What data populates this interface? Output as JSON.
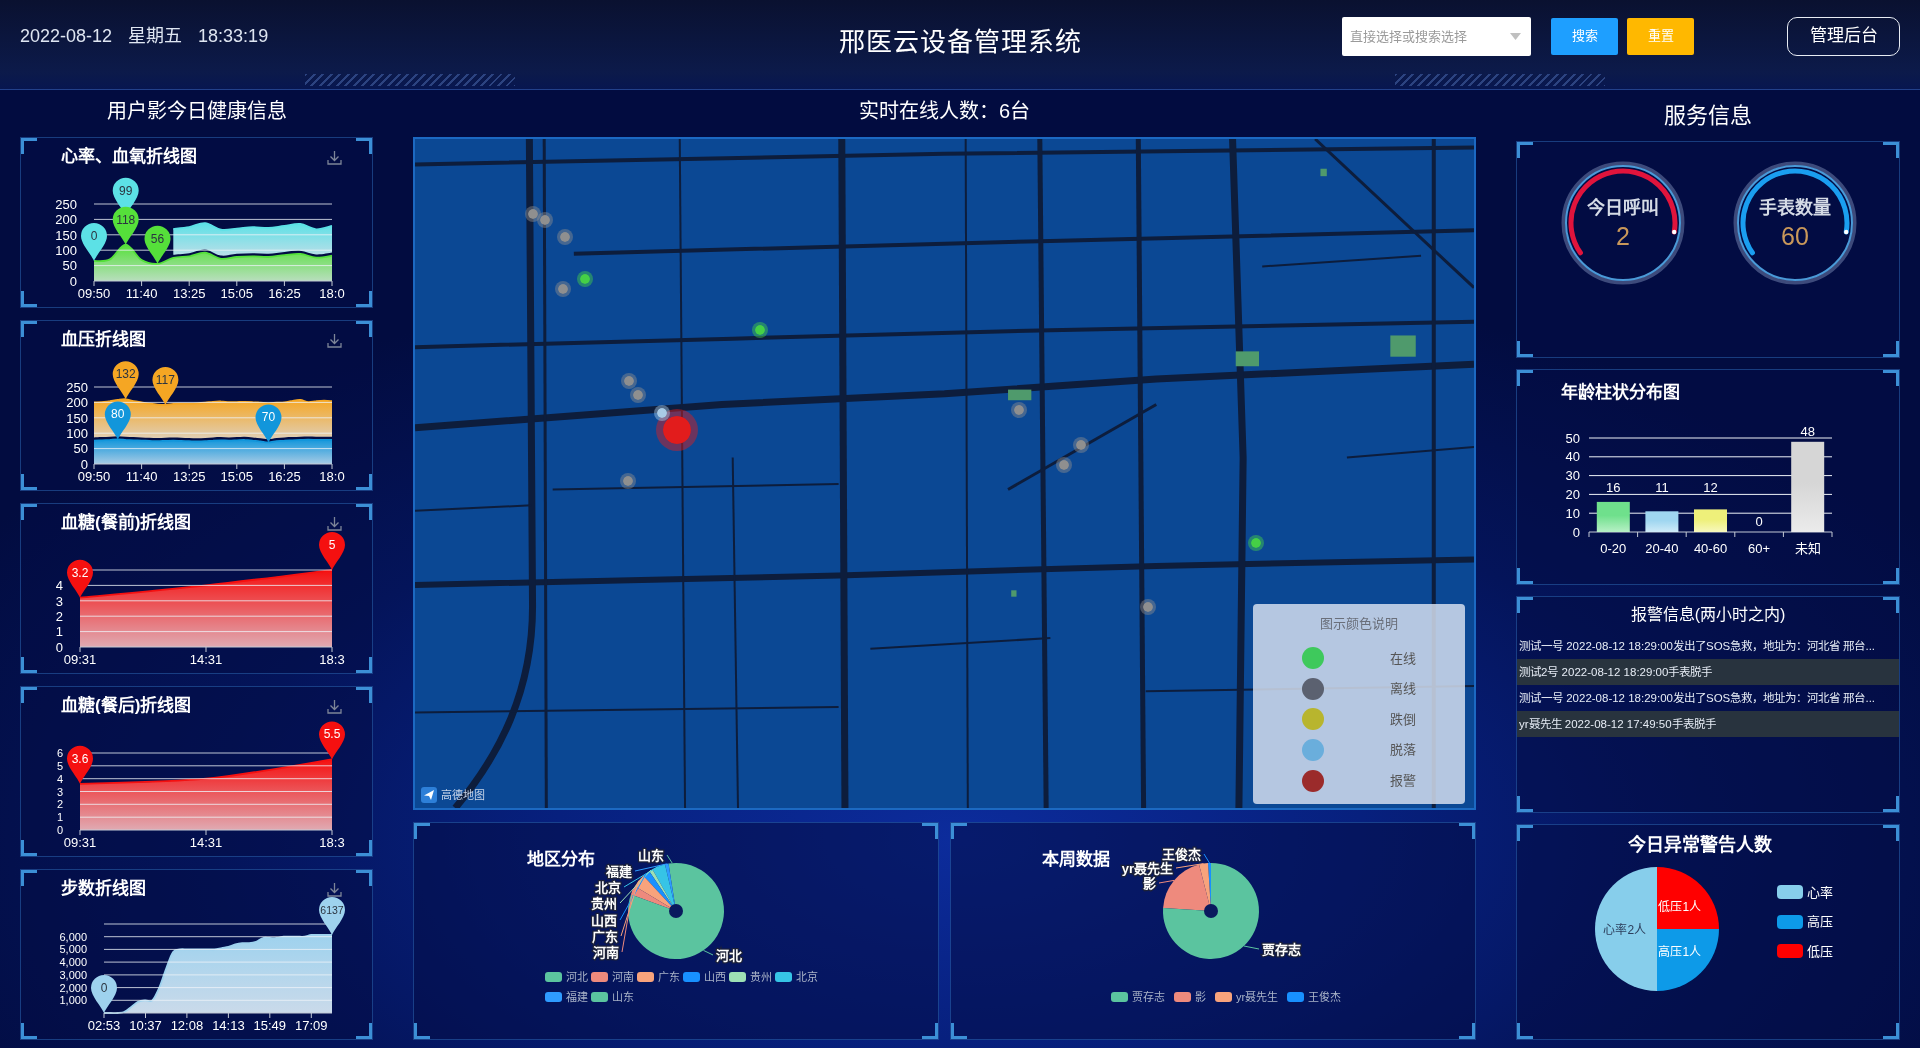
{
  "header": {
    "date": "2022-08-12",
    "weekday": "星期五",
    "time": "18:33:19",
    "title": "邢医云设备管理系统",
    "search": {
      "placeholder": "直接选择或搜索选择"
    },
    "buttons": [
      {
        "label": "搜索",
        "kind": "search"
      },
      {
        "label": "重置",
        "kind": "reset"
      }
    ],
    "admin_button": "管理后台"
  },
  "health": {
    "title": "用户影今日健康信息",
    "charts": [
      {
        "chart_data": {
          "type": "area",
          "title": "心率、血氧折线图",
          "stacked": true,
          "grid": true,
          "categories": [
            "09:50",
            null,
            null,
            "11:40",
            null,
            null,
            "13:25",
            null,
            null,
            "15:05",
            null,
            null,
            "16:25",
            null,
            null,
            "18:0"
          ],
          "ylim": [
            0,
            250
          ],
          "yticks": [
            0,
            50,
            100,
            150,
            200,
            250
          ],
          "series": [
            {
              "color": "#55e03a",
              "values": [
                65,
                70,
                118,
                68,
                56,
                75,
                80,
                92,
                72,
                78,
                80,
                78,
                84,
                88,
                76,
                82
              ]
            },
            {
              "color": "#5ce1e6",
              "values": [
                null,
                null,
                null,
                null,
                null,
                94,
                95,
                96,
                95,
                92,
                95,
                94,
                95,
                97,
                92,
                97
              ]
            }
          ],
          "annotations": [
            "99",
            "118",
            "0",
            "56"
          ]
        }
      },
      {
        "chart_data": {
          "type": "area",
          "title": "血压折线图",
          "stacked": true,
          "grid": true,
          "categories": [
            "09:50",
            null,
            null,
            null,
            null,
            null,
            "11:40",
            null,
            null,
            null,
            null,
            null,
            "13:25",
            null,
            null,
            null,
            null,
            null,
            "15:05",
            null,
            null,
            null,
            null,
            null,
            "16:25",
            null,
            null,
            null,
            null,
            null,
            "18:0"
          ],
          "ylim": [
            0,
            250
          ],
          "yticks": [
            0,
            50,
            100,
            150,
            200,
            250
          ],
          "series": [
            {
              "color": "#1296db",
              "values": [
                76,
                77,
                78,
                80,
                78,
                77,
                76,
                75,
                74,
                75,
                76,
                75,
                74,
                73,
                74,
                76,
                77,
                76,
                77,
                78,
                76,
                73,
                70,
                74,
                76,
                77,
                78,
                79,
                78,
                78,
                78
              ]
            },
            {
              "color": "#f5a623",
              "values": [
                124,
                124,
                126,
                128,
                132,
                127,
                124,
                121,
                119,
                117,
                119,
                121,
                122,
                124,
                125,
                126,
                126,
                125,
                124,
                124,
                125,
                126,
                127,
                125,
                124,
                128,
                130,
                122,
                126,
                128,
                126
              ]
            }
          ],
          "annotations": [
            "132",
            "117",
            "80",
            "70"
          ]
        }
      },
      {
        "chart_data": {
          "type": "area",
          "title": "血糖(餐前)折线图",
          "grid": true,
          "categories": [
            "09:31",
            "14:31",
            "18:3"
          ],
          "ylim": [
            0,
            5
          ],
          "yticks": [
            0,
            1,
            2,
            3,
            4
          ],
          "series": [
            {
              "color": "#f51010",
              "values": [
                3.2,
                4,
                5
              ]
            }
          ],
          "annotations": [
            "3.2",
            "5"
          ]
        }
      },
      {
        "chart_data": {
          "type": "area",
          "title": "血糖(餐后)折线图",
          "grid": true,
          "categories": [
            "09:31",
            "14:31",
            "18:3"
          ],
          "ylim": [
            0,
            6
          ],
          "yticks": [
            0,
            1,
            2,
            3,
            4,
            5,
            6
          ],
          "series": [
            {
              "color": "#f51010",
              "values": [
                3.6,
                4,
                5.5
              ]
            }
          ],
          "annotations": [
            "3.6",
            "5.5"
          ]
        }
      },
      {
        "chart_data": {
          "type": "area",
          "title": "步数折线图",
          "grid": true,
          "categories": [
            "02:53",
            null,
            null,
            null,
            null,
            null,
            "10:37",
            null,
            null,
            null,
            null,
            null,
            "12:08",
            null,
            null,
            null,
            null,
            null,
            "14:13",
            null,
            null,
            null,
            null,
            null,
            "15:49",
            null,
            null,
            null,
            null,
            null,
            "17:09",
            null,
            null,
            null
          ],
          "ylim": [
            0,
            7000
          ],
          "yticks": [
            {
              "value": 1000,
              "label": "1,000"
            },
            {
              "value": 2000,
              "label": "2,000"
            },
            {
              "value": 3000,
              "label": "3,000"
            },
            {
              "value": 4000,
              "label": "4,000"
            },
            {
              "value": 5000,
              "label": "5,000"
            },
            {
              "value": 6000,
              "label": "6,000"
            }
          ],
          "series": [
            {
              "color": "#9ed2ee",
              "values": [
                0,
                0,
                0,
                100,
                500,
                900,
                1000,
                1000,
                2000,
                3500,
                4800,
                5000,
                5000,
                5000,
                5000,
                5000,
                5000,
                5100,
                5200,
                5400,
                5500,
                5500,
                5600,
                5900,
                5900,
                5900,
                6000,
                6000,
                6000,
                6000,
                6137,
                6137,
                6137,
                6137
              ]
            }
          ],
          "annotations": [
            "0",
            "6137"
          ]
        }
      }
    ]
  },
  "online": {
    "title": "实时在线人数：6台",
    "map": {
      "markers": [
        {
          "kind": "device",
          "color": "#45d046"
        },
        {
          "kind": "device",
          "color": "#45d046"
        },
        {
          "kind": "device",
          "color": "#45d046"
        },
        {
          "kind": "device",
          "color": "#8f8f8f"
        },
        {
          "kind": "device",
          "color": "#8f8f8f"
        },
        {
          "kind": "device",
          "color": "#8f8f8f"
        },
        {
          "kind": "device",
          "color": "#8f8f8f"
        },
        {
          "kind": "device",
          "color": "#8f8f8f"
        },
        {
          "kind": "device",
          "color": "#8f8f8f"
        },
        {
          "kind": "device",
          "color": "#8f8f8f"
        },
        {
          "kind": "device",
          "color": "#8f8f8f"
        },
        {
          "kind": "device",
          "color": "#8f8f8f"
        },
        {
          "kind": "device",
          "color": "#8f8f8f"
        },
        {
          "kind": "device",
          "color": "#8f8f8f"
        },
        {
          "kind": "alarm",
          "color": "#e21c1c"
        },
        {
          "kind": "device",
          "color": "#a9cbe6"
        }
      ],
      "legend": {
        "title": "图示颜色说明",
        "items": [
          {
            "label": "在线",
            "color": "#3ec95c"
          },
          {
            "label": "离线",
            "color": "#5b6170"
          },
          {
            "label": "跌倒",
            "color": "#b8b52e"
          },
          {
            "label": "脱落",
            "color": "#6aaedc"
          },
          {
            "label": "报警",
            "color": "#9b2b2b"
          }
        ]
      },
      "attribution": "高德地图"
    }
  },
  "region_chart": {
    "title": "地区分布",
    "slice_labels": [
      "山东",
      "福建",
      "北京",
      "贵州",
      "山西",
      "广东",
      "河南",
      "河北"
    ],
    "legend": [
      {
        "label": "河北",
        "color": "#5bc49f"
      },
      {
        "label": "河南",
        "color": "#ee8a7d"
      },
      {
        "label": "广东",
        "color": "#f8a37c"
      },
      {
        "label": "山西",
        "color": "#1890ff"
      },
      {
        "label": "贵州",
        "color": "#9de0b5"
      },
      {
        "label": "北京",
        "color": "#36c4e6"
      },
      {
        "label": "福建",
        "color": "#2f9bff"
      },
      {
        "label": "山东",
        "color": "#5bc49f"
      }
    ]
  },
  "week_chart": {
    "title": "本周数据",
    "slice_labels": [
      "王俊杰",
      "yr聂先生",
      "影",
      "贾存志"
    ],
    "legend": [
      {
        "label": "贾存志",
        "color": "#5bc49f"
      },
      {
        "label": "影",
        "color": "#ee8a7d"
      },
      {
        "label": "yr聂先生",
        "color": "#f8a37c"
      },
      {
        "label": "王俊杰",
        "color": "#1890ff"
      }
    ]
  },
  "service": {
    "title": "服务信息",
    "gauges": [
      {
        "label": "今日呼叫",
        "value": "2",
        "color": "#e0143c"
      },
      {
        "label": "手表数量",
        "value": "60",
        "color": "#1a9ef0"
      }
    ],
    "age_chart": {
      "chart_data": {
        "type": "bar",
        "title": "年龄柱状分布图",
        "grid": true,
        "categories": [
          "0-20",
          "20-40",
          "40-60",
          "60+",
          "未知"
        ],
        "values": [
          16,
          11,
          12,
          0,
          48
        ],
        "ylim": [
          0,
          50
        ],
        "yticks": [
          0,
          10,
          20,
          30,
          40,
          50
        ],
        "data_labels": true
      }
    },
    "alarms": {
      "title": "报警信息(两小时之内)",
      "rows": [
        "测试一号 2022-08-12 18:29:00发出了SOS急救，地址为：河北省 邢台...",
        "测试2号 2022-08-12 18:29:00手表脱手",
        "测试一号 2022-08-12 18:29:00发出了SOS急救，地址为：河北省 邢台...",
        "yr聂先生 2022-08-12 17:49:50手表脱手"
      ]
    },
    "warning_chart": {
      "slices": [
        {
          "color": "#87ceeb"
        },
        {
          "color": "#0d9ae8"
        },
        {
          "color": "#ff0000"
        }
      ],
      "chart_data": {
        "type": "pie",
        "title": "今日异常警告人数",
        "categories": [
          "心率",
          "高压",
          "低压"
        ],
        "values": [
          2,
          1,
          1
        ],
        "value_labels": [
          "心率2人",
          "高压1人",
          "低压1人"
        ],
        "legend": "right"
      }
    }
  }
}
